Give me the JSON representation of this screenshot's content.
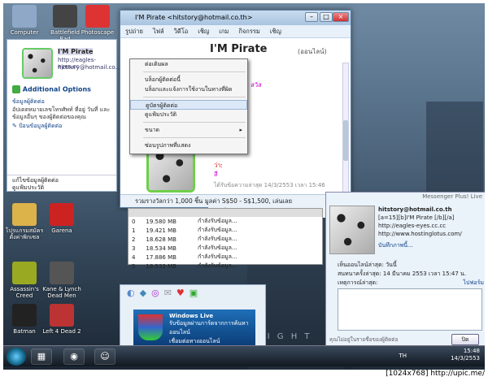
{
  "desktop": {
    "icons": [
      {
        "label": "Computer",
        "color": "#8fa8c8"
      },
      {
        "label": "Battlefield Bad Company 2",
        "color": "#444"
      },
      {
        "label": "Photoscape",
        "color": "#d33"
      },
      {
        "label": "โปรแกรมสมัคร ตั้งค่าพิกเซล",
        "color": "#dcb24a"
      },
      {
        "label": "Garena",
        "color": "#c22"
      },
      {
        "label": "Assassin's Creed",
        "color": "#9a2"
      },
      {
        "label": "Kane & Lynch Dead Men",
        "color": "#555"
      },
      {
        "label": "Batman",
        "color": "#222"
      },
      {
        "label": "Left 4 Dead 2",
        "color": "#b33"
      }
    ],
    "watermark": "T H E   D A R K   K N I G H T"
  },
  "card": {
    "name": "I'M Pirate",
    "url": "http://eagles-eyes.cc",
    "email": "hitstory@hotmail.co...",
    "additional": "Additional Options",
    "section": "ข้อมูลผู้ติดต่อ",
    "desc": "อัปเดตหมายเลขโทรศัพท์ ที่อยู่ วันที่ และข้อมูลอื่นๆ ของผู้ติดต่อของคุณ",
    "edit": "ป้อนข้อมูลผู้ติดต่อ",
    "bottom1": "แก้ไขข้อมูลผู้ติดต่อ",
    "bottom2": "ดูแฟ้มประวัติ"
  },
  "msn": {
    "title": "I'M Pirate  <hitstory@hotmail.co.th>",
    "menu": [
      "รูปถ่าย",
      "ไฟล์",
      "วิดีโอ",
      "เชิญ",
      "เกม",
      "กิจกรรม",
      "เชิญ"
    ],
    "contact_name": "I'M Pirate",
    "contact_status": "(ออนไลน์)",
    "chat": [
      {
        "text": "",
        "cls": ""
      },
      {
        "text": "ว่า:",
        "cls": "red"
      },
      {
        "text": "ดีดับดีดับบน่ะ สวัส",
        "cls": "mag"
      },
      {
        "text": "",
        "cls": ""
      },
      {
        "text": "ว่า:",
        "cls": "red"
      },
      {
        "text": "IS LIVE สี",
        "cls": "mag"
      },
      {
        "text": "",
        "cls": ""
      },
      {
        "text": "ว่า:",
        "cls": "red"
      },
      {
        "text": "",
        "cls": ""
      },
      {
        "text": "ว่า:",
        "cls": "red"
      },
      {
        "text": "",
        "cls": ""
      },
      {
        "text": "ว่า:",
        "cls": "red"
      },
      {
        "text": "สี",
        "cls": "mag"
      }
    ],
    "last_msg": "ได้รับข้อความล่าสุด 14/3/2553 เวลา 15:46",
    "promo": "รวมรางวัลกว่า 1,000 ชิ้น  มูลค่า S$50 - S$1,500, เล่นเลย"
  },
  "context_menu": [
    {
      "label": "ต่อเติมผล",
      "sep_after": true
    },
    {
      "label": "บล็อกผู้ติดต่อนี้"
    },
    {
      "label": "บล็อกและแจ้งการใช้งานในทางที่ผิด",
      "sep_after": true
    },
    {
      "label": "ดูบัตรผู้ติดต่อ",
      "highlight": true
    },
    {
      "label": "ดูแฟ้มประวัติ",
      "sep_after": true
    },
    {
      "label": "ขนาด",
      "submenu": true,
      "sep_after": true
    },
    {
      "label": "ซ่อนรูปภาพที่แสดง"
    }
  ],
  "transfers": {
    "header": "",
    "rows": [
      {
        "n": "0",
        "size": "19.580 MB",
        "status": "กำลังรับข้อมูล..."
      },
      {
        "n": "1",
        "size": "19.421 MB",
        "status": "กำลังรับข้อมูล..."
      },
      {
        "n": "2",
        "size": "18.628 MB",
        "status": "กำลังรับข้อมูล..."
      },
      {
        "n": "3",
        "size": "18.534 MB",
        "status": "กำลังรับข้อมูล..."
      },
      {
        "n": "4",
        "size": "17.886 MB",
        "status": "กำลังรับข้อมูล..."
      },
      {
        "n": "5",
        "size": "18.533 MB",
        "status": "กำลังรับข้อมูล..."
      }
    ]
  },
  "banner": {
    "line1": "Windows Live",
    "line2": "รับข้อมูลผ่านการ์ดจากการค้นหาออนไลน์",
    "line3": "เชื่อมต่อทางออนไลน์"
  },
  "plus": {
    "header": "Messenger Plus! Live",
    "email": "hitstory@hotmail.co.th",
    "line1": "[a=15][b]I'M Pirate [/b][/a]",
    "line2": "http://eagles-eyes.cc.cc",
    "line3": "http://www.hostinglotus.com/",
    "action": "บันทึกภาพนี้...",
    "seen": "เห็นออนไลน์ล่าสุด: วันนี้",
    "chat": "สนทนาครั้งล่าสุด: 14 มีนาคม 2553 เวลา 15:47 น.",
    "note_label": "เหตุการณ์ล่าสุด:",
    "note_link": "ไปฟอร์ม",
    "footer": "คุณไม่อยู่ในรายชื่อของผู้ติดต่อ",
    "ok": "ปิด"
  },
  "taskbar": {
    "lang": "TH",
    "time": "15:48",
    "date": "14/3/2553"
  },
  "footer": "[1024x768] http://upic.me/"
}
